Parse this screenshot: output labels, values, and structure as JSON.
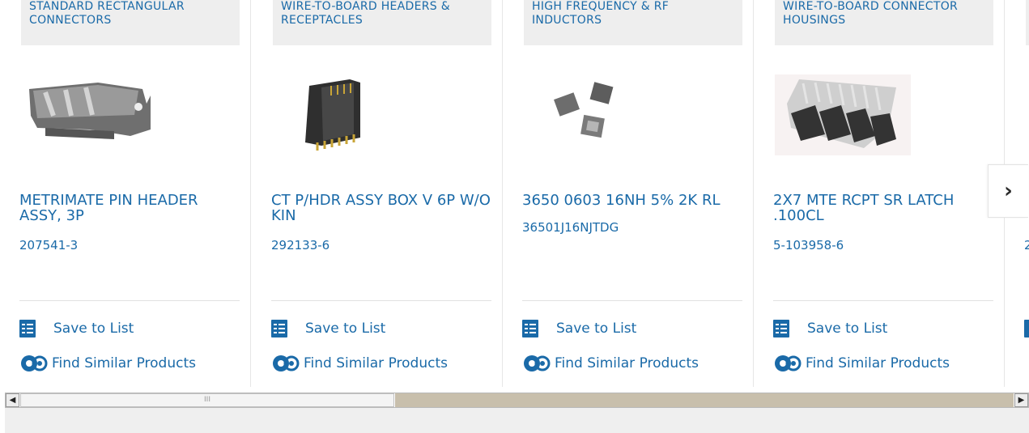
{
  "products": [
    {
      "category": "STANDARD RECTANGULAR CONNECTORS",
      "name": "METRIMATE PIN HEADER ASSY, 3P",
      "part_number": "207541-3",
      "image_icon": "connector-header-image"
    },
    {
      "category": "WIRE-TO-BOARD HEADERS & RECEPTACLES",
      "name": "CT P/HDR ASSY BOX V 6P W/O KIN",
      "part_number": "292133-6",
      "image_icon": "pin-header-image"
    },
    {
      "category": "HIGH FREQUENCY & RF INDUCTORS",
      "name": "3650 0603 16nH 5% 2K RL",
      "part_number": "36501J16NJTDG",
      "image_icon": "inductor-image"
    },
    {
      "category": "WIRE-TO-BOARD CONNECTOR HOUSINGS",
      "name": "2X7 MTE RCPT SR LATCH .100CL",
      "part_number": "5-103958-6",
      "image_icon": "housing-image"
    }
  ],
  "actions": {
    "save_label": "Save to List",
    "find_label": "Find Similar Products"
  },
  "partial_card": {
    "part_number_fragment": "2"
  },
  "scrollbar": {
    "thumb_grip": "III",
    "left_arrow": "◀",
    "right_arrow": "▶"
  },
  "next_button": "›",
  "colors": {
    "link": "#1a6aa8",
    "category_bg": "#eeeeee",
    "scroll_track": "#c8bfac"
  }
}
